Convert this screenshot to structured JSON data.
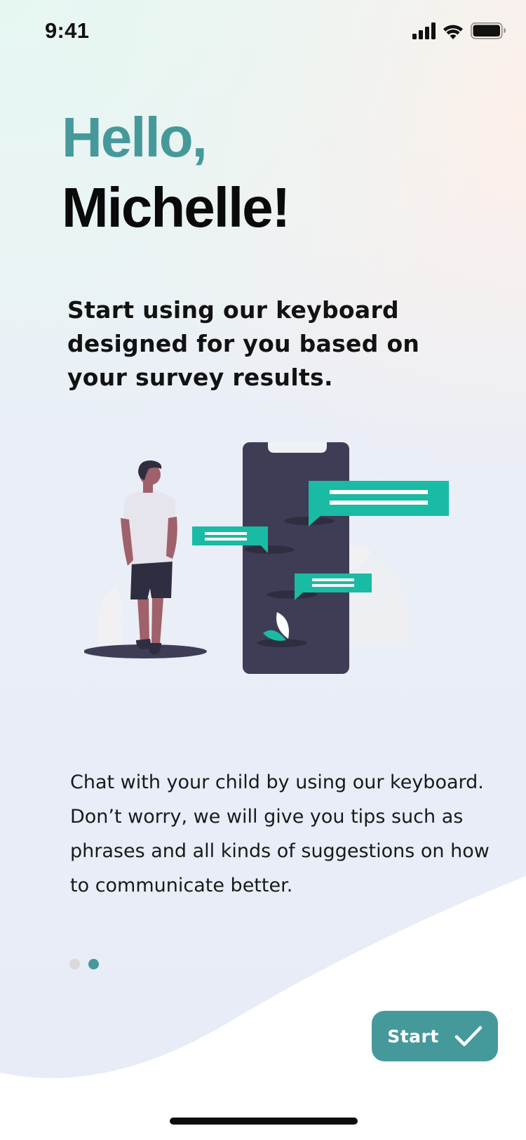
{
  "status_bar": {
    "time": "9:41"
  },
  "greeting": {
    "hello": "Hello,",
    "name": "Michelle!"
  },
  "subtitle": "Start using our keyboard designed for you based on your survey results.",
  "body_text": "Chat with your child by using our keyboard. Don’t worry, we will give you tips such as phrases and all kinds of suggestions on how to communicate better.",
  "pager": {
    "total": 2,
    "active_index": 1
  },
  "start_button": {
    "label": "Start"
  },
  "colors": {
    "accent": "#46999b",
    "chat_bubble": "#19bba4",
    "phone": "#3f3d56"
  },
  "icons": {
    "signal": "cellular-signal-icon",
    "wifi": "wifi-icon",
    "battery": "battery-icon",
    "check": "checkmark-icon"
  }
}
